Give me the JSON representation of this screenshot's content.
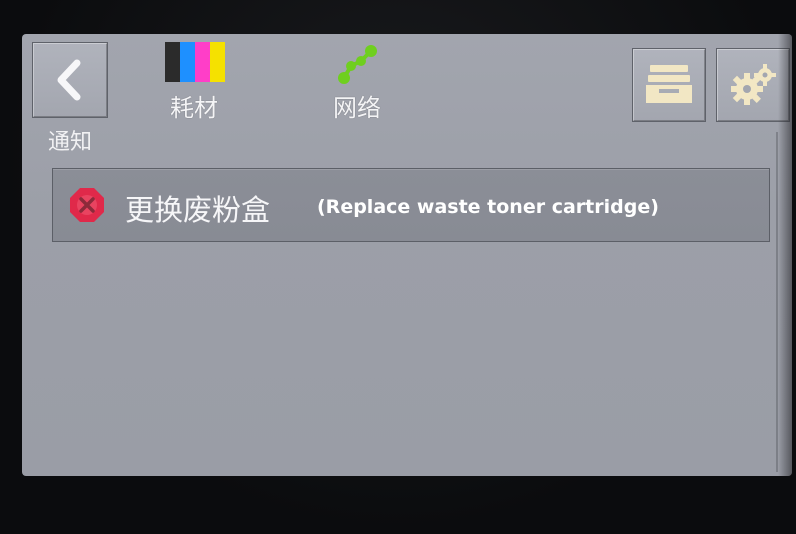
{
  "nav": {
    "back_icon": "chevron-left-icon",
    "tabs": [
      {
        "label": "耗材",
        "icon": "color-toner-icon",
        "colors": [
          "#2b2b2b",
          "#1e90ff",
          "#ff3ec8",
          "#f5e100"
        ]
      },
      {
        "label": "网络",
        "icon": "network-icon",
        "color": "#6fcf1f"
      }
    ],
    "tray_icon": "paper-tray-icon",
    "settings_icon": "gear-icon"
  },
  "section": {
    "title": "通知"
  },
  "notifications": [
    {
      "text": "更换废粉盒",
      "caption": "(Replace waste toner cartridge)",
      "severity_icon": "error-x-icon",
      "severity_color": "#e0294a"
    }
  ],
  "colors": {
    "screen_bg": "#9c9fa8",
    "text": "#f4f4f6",
    "icon_cream": "#f2e7c4"
  }
}
